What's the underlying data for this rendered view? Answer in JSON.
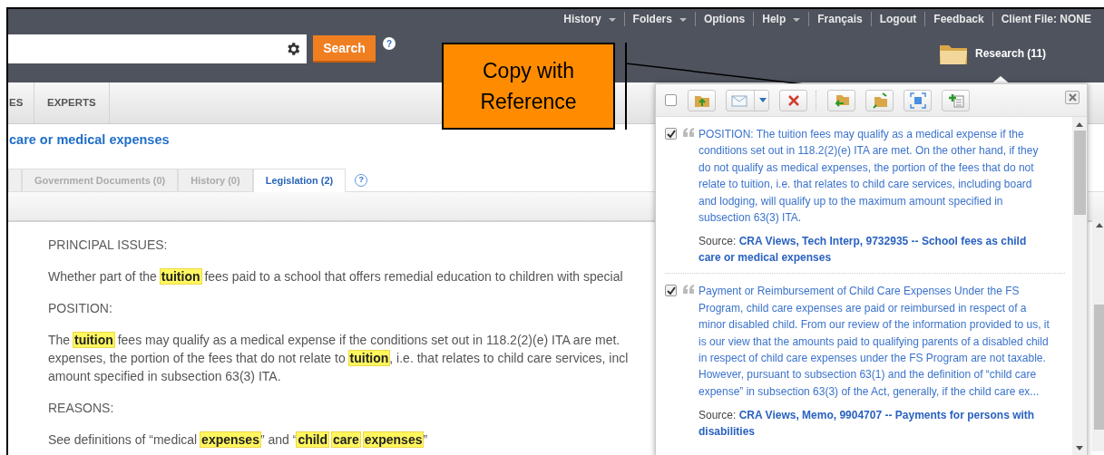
{
  "top_nav": [
    {
      "label": "History",
      "dropdown": true
    },
    {
      "label": "Folders",
      "dropdown": true
    },
    {
      "label": "Options",
      "dropdown": false
    },
    {
      "label": "Help",
      "dropdown": true
    },
    {
      "label": "Français",
      "dropdown": false
    },
    {
      "label": "Logout",
      "dropdown": false
    },
    {
      "label": "Feedback",
      "dropdown": false
    },
    {
      "label": "Client File: NONE",
      "dropdown": false
    }
  ],
  "search": {
    "button": "Search",
    "help": "?"
  },
  "research": {
    "label": "Research (11)"
  },
  "callout": {
    "lines": [
      "Copy with",
      "Reference"
    ]
  },
  "main_tabs": [
    {
      "label": "ES"
    },
    {
      "label": "EXPERTS"
    }
  ],
  "document_title": "care or medical expenses",
  "doc_tabs": [
    {
      "label": "Government Documents (0)",
      "selected": false
    },
    {
      "label": "History (0)",
      "selected": false
    },
    {
      "label": "Legislation (2)",
      "selected": true
    }
  ],
  "doc_tabs_help": "?",
  "content": [
    {
      "kind": "heading",
      "lines": [
        "PRINCIPAL ISSUES:"
      ]
    },
    {
      "kind": "paragraph",
      "lines": [
        "Whether part of the **tuition** fees paid to a school that offers remedial education to children with special"
      ]
    },
    {
      "kind": "heading",
      "lines": [
        "POSITION:"
      ]
    },
    {
      "kind": "paragraph",
      "lines": [
        "The **tuition** fees may qualify as a medical expense if the conditions set out in 118.2(2)(e) ITA are met.",
        "expenses, the portion of the fees that do not relate to **tuition**, i.e. that relates to child care services, incl",
        "amount specified in subsection 63(3) ITA."
      ]
    },
    {
      "kind": "heading",
      "lines": [
        "REASONS:"
      ]
    },
    {
      "kind": "paragraph",
      "lines": [
        "See definitions of “medical **expenses**” and “**child** **care** **expenses**”"
      ]
    }
  ],
  "research_panel": {
    "select_all_checked": false,
    "items": [
      {
        "checked": true,
        "text": "POSITION: The tuition fees may qualify as a medical expense if the conditions set out in 118.2(2)(e) ITA are met. On the other hand, if they do not qualify as medical expenses, the portion of the fees that do not relate to tuition, i.e. that relates to child care services, including board and lodging, will qualify up to the maximum amount specified in subsection 63(3) ITA.",
        "source_label": "Source:",
        "source": "CRA Views, Tech Interp, 9732935 -- School fees as child care or medical expenses"
      },
      {
        "checked": true,
        "text": "Payment or Reimbursement of Child Care Expenses Under the FS Program, child care expenses are paid or reimbursed in respect of a minor disabled child. From our review of the information provided to us, it is our view that the amounts paid to qualifying parents of a disabled child in respect of child care expenses under the FS Program are not taxable. However, pursuant to subsection 63(1) and the definition of “child care expense” in subsection 63(3) of the Act, generally, if the child care ex...",
        "source_label": "Source:",
        "source": "CRA Views, Memo, 9904707 -- Payments for persons with disabilities"
      }
    ]
  }
}
